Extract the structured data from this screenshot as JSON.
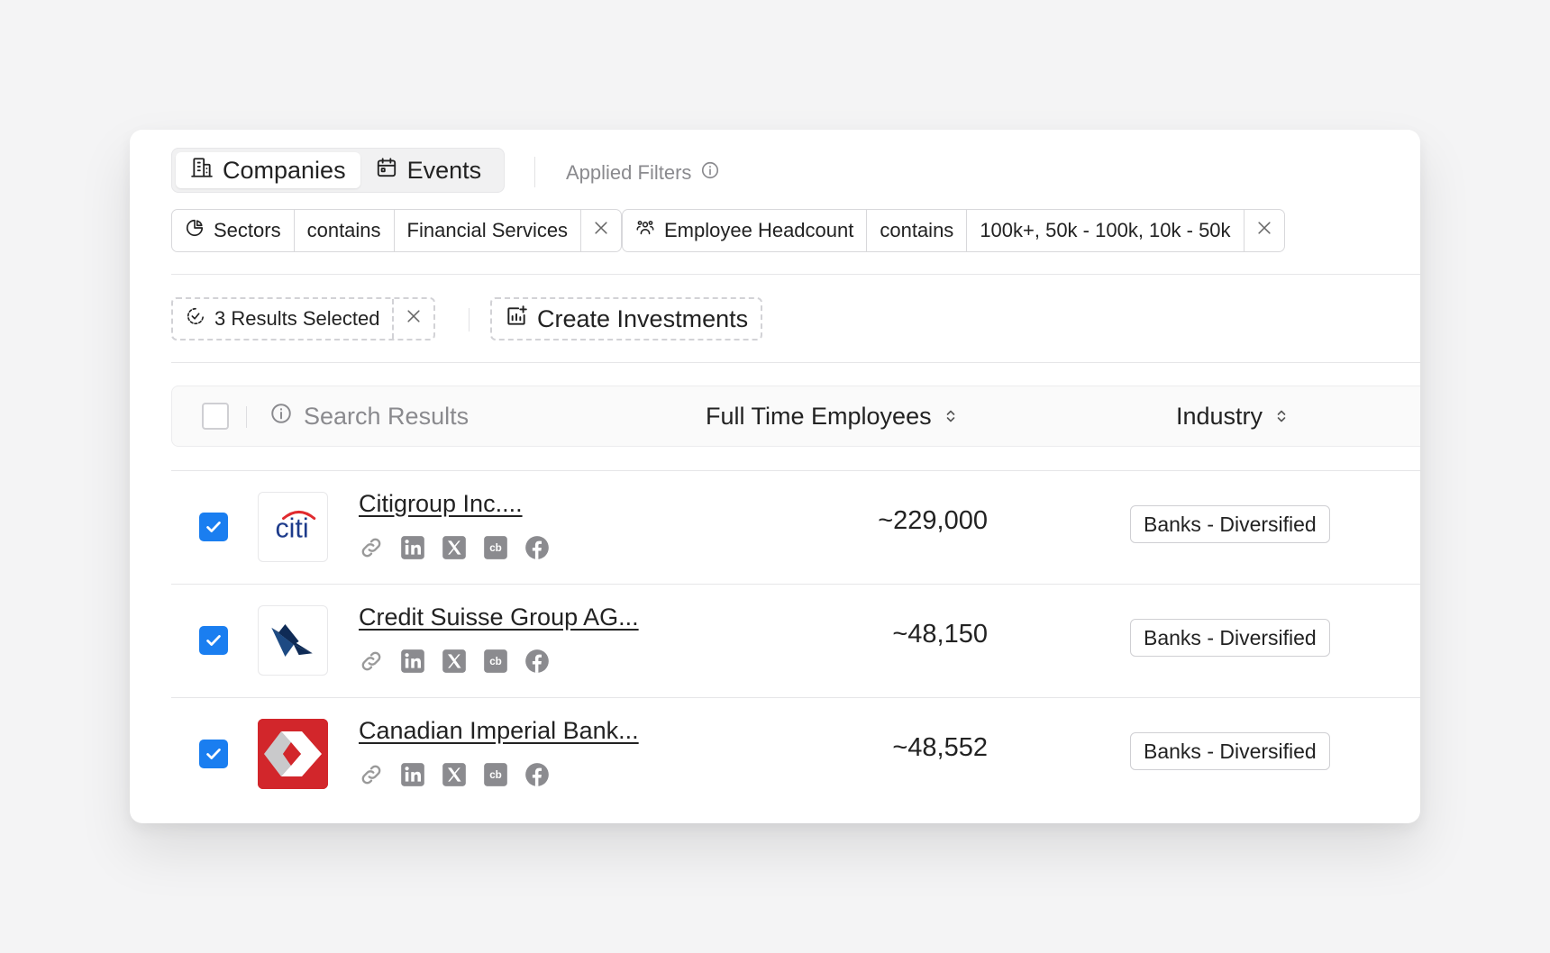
{
  "tabs": [
    {
      "label": "Companies",
      "icon": "building-icon",
      "active": true
    },
    {
      "label": "Events",
      "icon": "calendar-icon",
      "active": false
    }
  ],
  "applied_filters_label": "Applied Filters",
  "filters": [
    {
      "field": "Sectors",
      "operator": "contains",
      "value": "Financial Services"
    },
    {
      "field": "Employee Headcount",
      "operator": "contains",
      "value": "100k+, 50k - 100k, 10k - 50k"
    }
  ],
  "selection": {
    "label": "3 Results Selected"
  },
  "create_label": "Create Investments",
  "table": {
    "search_label": "Search Results",
    "col_employees": "Full Time Employees",
    "col_industry": "Industry",
    "rows": [
      {
        "name": "Citigroup Inc....",
        "employees": "~229,000",
        "industry": "Banks - Diversified",
        "logo_text": "citi",
        "checked": true
      },
      {
        "name": "Credit Suisse Group AG...",
        "employees": "~48,150",
        "industry": "Banks - Diversified",
        "checked": true
      },
      {
        "name": "Canadian Imperial Bank...",
        "employees": "~48,552",
        "industry": "Banks - Diversified",
        "checked": true
      }
    ]
  },
  "colors": {
    "accent": "#1a7ef0",
    "cibc_red": "#d2262b",
    "citi_blue": "#1d3b8b",
    "cs_navy": "#0f2b56"
  }
}
